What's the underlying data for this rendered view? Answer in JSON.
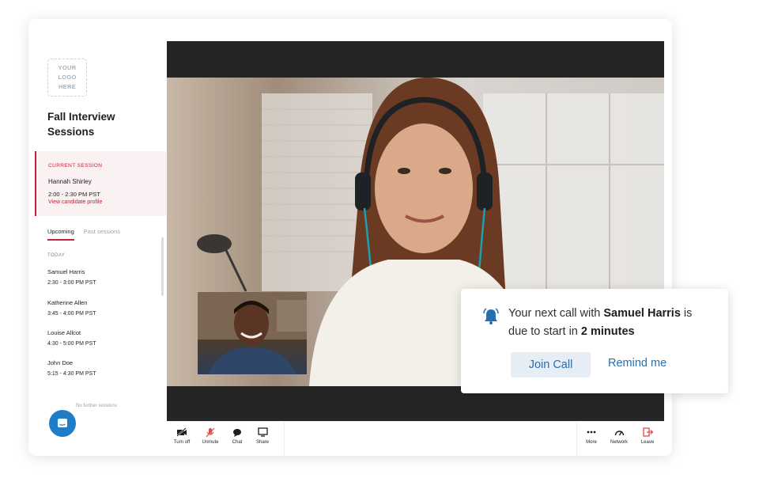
{
  "window": {
    "controls": [
      "#ec5a55",
      "#f0ad4e",
      "#3fc54e"
    ]
  },
  "sidebar": {
    "logo": "YOUR LOGO HERE",
    "title": "Fall Interview Sessions",
    "current": {
      "label": "CURRENT SESSION",
      "name": "Hannah Shirley",
      "time": "2:00 - 2:30 PM PST",
      "link": "View candidate profile"
    },
    "tabs": [
      {
        "label": "Upcoming"
      },
      {
        "label": "Past sessions"
      }
    ],
    "today_label": "TODAY",
    "sessions": [
      {
        "name": "Samuel Harris",
        "time": "2:30 - 3:00 PM PST"
      },
      {
        "name": "Katherine Allen",
        "time": "3:45 - 4:00 PM PST"
      },
      {
        "name": "Louise Allcot",
        "time": "4:30 - 5:00 PM PST"
      },
      {
        "name": "John Doe",
        "time": "5:15 - 4:30 PM PST"
      }
    ],
    "no_further": "No further sessions"
  },
  "toolbar": {
    "left": [
      {
        "label": "Turn off",
        "icon": "video-off-icon"
      },
      {
        "label": "Unmute",
        "icon": "mic-off-icon"
      },
      {
        "label": "Chat",
        "icon": "chat-icon"
      },
      {
        "label": "Share",
        "icon": "screen-share-icon"
      }
    ],
    "right": [
      {
        "label": "More",
        "icon": "more-icon"
      },
      {
        "label": "Network",
        "icon": "network-gauge-icon"
      },
      {
        "label": "Leave",
        "icon": "leave-icon"
      }
    ]
  },
  "notification": {
    "prefix": "Your next call with ",
    "name": "Samuel Harris",
    "mid": " is due to start in ",
    "time": "2 minutes",
    "join": "Join Call",
    "remind": "Remind me"
  },
  "colors": {
    "accent": "#c3203a",
    "primary": "#2270b3",
    "bubble": "#1f7cc6"
  }
}
